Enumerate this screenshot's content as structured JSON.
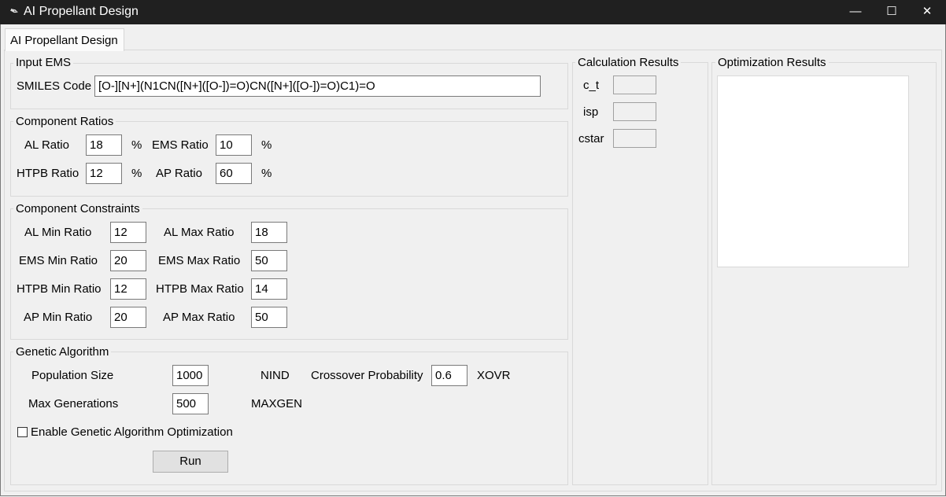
{
  "window": {
    "title": "AI Propellant Design",
    "minimize": "—",
    "maximize": "☐",
    "close": "✕"
  },
  "tab": {
    "label": "AI Propellant Design"
  },
  "input_ems": {
    "legend": "Input EMS",
    "smiles_label": "SMILES Code",
    "smiles_value": "[O-][N+](N1CN([N+]([O-])=O)CN([N+]([O-])=O)C1)=O"
  },
  "component_ratios": {
    "legend": "Component Ratios",
    "al_label": "AL Ratio",
    "al_value": "18",
    "ems_label": "EMS Ratio",
    "ems_value": "10",
    "htpb_label": "HTPB Ratio",
    "htpb_value": "12",
    "ap_label": "AP Ratio",
    "ap_value": "60",
    "percent": "%"
  },
  "constraints": {
    "legend": "Component Constraints",
    "al_min_label": "AL Min Ratio",
    "al_min": "12",
    "al_max_label": "AL Max Ratio",
    "al_max": "18",
    "ems_min_label": "EMS Min Ratio",
    "ems_min": "20",
    "ems_max_label": "EMS Max Ratio",
    "ems_max": "50",
    "htpb_min_label": "HTPB Min Ratio",
    "htpb_min": "12",
    "htpb_max_label": "HTPB Max Ratio",
    "htpb_max": "14",
    "ap_min_label": "AP Min Ratio",
    "ap_min": "20",
    "ap_max_label": "AP Max Ratio",
    "ap_max": "50"
  },
  "genetic": {
    "legend": "Genetic Algorithm",
    "pop_label": "Population Size",
    "pop_value": "1000",
    "pop_code": "NIND",
    "xovr_label": "Crossover Probability",
    "xovr_value": "0.6",
    "xovr_code": "XOVR",
    "gen_label": "Max Generations",
    "gen_value": "500",
    "gen_code": "MAXGEN",
    "enable_label": "Enable Genetic Algorithm Optimization",
    "enable_checked": false,
    "run_label": "Run"
  },
  "calc_results": {
    "legend": "Calculation Results",
    "ct_label": "c_t",
    "isp_label": "isp",
    "cstar_label": "cstar"
  },
  "opt_results": {
    "legend": "Optimization Results"
  }
}
